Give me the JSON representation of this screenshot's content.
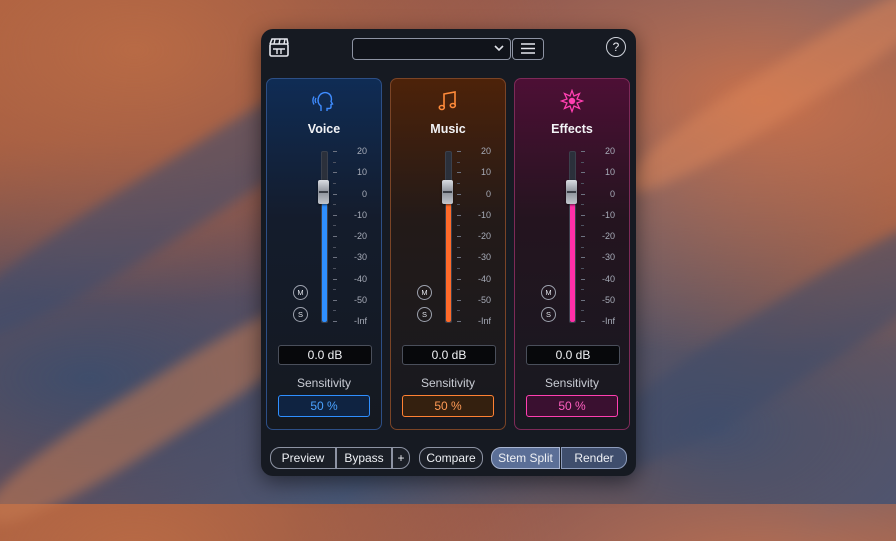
{
  "app": {
    "preset": {
      "value": ""
    },
    "help_label": "?"
  },
  "panels": [
    {
      "key": "voice",
      "title": "Voice",
      "gain_db": "0.0 dB",
      "sensitivity_label": "Sensitivity",
      "sensitivity": "50 %",
      "mute_label": "M",
      "solo_label": "S",
      "fader_level_db": 0,
      "accent": "#2f8fff",
      "icon": "voice-head-icon"
    },
    {
      "key": "music",
      "title": "Music",
      "gain_db": "0.0 dB",
      "sensitivity_label": "Sensitivity",
      "sensitivity": "50 %",
      "mute_label": "M",
      "solo_label": "S",
      "fader_level_db": 0,
      "accent": "#ff7a30",
      "icon": "music-note-icon"
    },
    {
      "key": "effects",
      "title": "Effects",
      "gain_db": "0.0 dB",
      "sensitivity_label": "Sensitivity",
      "sensitivity": "50 %",
      "mute_label": "M",
      "solo_label": "S",
      "fader_level_db": 0,
      "accent": "#ff3fb0",
      "icon": "effects-burst-icon"
    }
  ],
  "scale": [
    "20",
    "10",
    "0",
    "-10",
    "-20",
    "-30",
    "-40",
    "-50",
    "-Inf"
  ],
  "bottom": {
    "preview": "Preview",
    "bypass": "Bypass",
    "plus": "+",
    "compare": "Compare",
    "stem_split": "Stem Split",
    "render": "Render"
  }
}
